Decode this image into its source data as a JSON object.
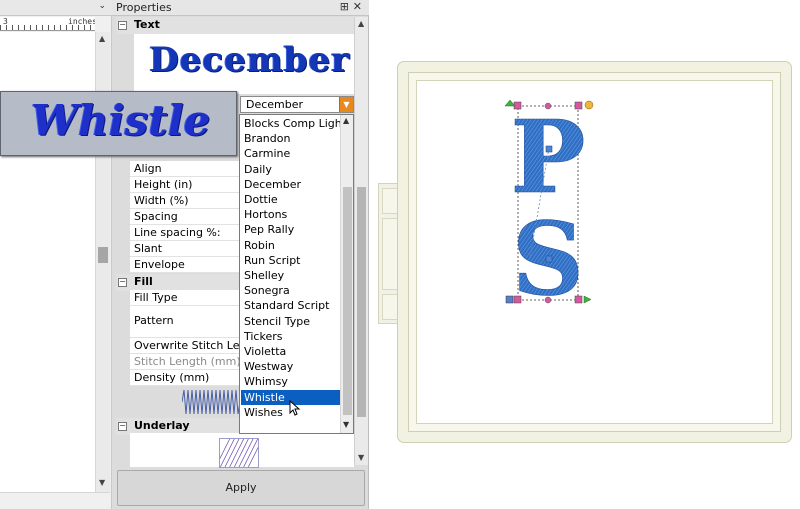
{
  "left_panel": {
    "ruler_number": "3",
    "ruler_unit": "inches",
    "header_chevron": "⌄"
  },
  "properties_panel": {
    "title": "Properties",
    "pin_glyph": "⊞",
    "close_glyph": "✕",
    "sections": {
      "text": {
        "label": "Text",
        "toggle": "−"
      },
      "fill": {
        "label": "Fill",
        "toggle": "−"
      },
      "underlay": {
        "label": "Underlay",
        "toggle": "−"
      }
    },
    "preview_text": "December",
    "font_combo_value": "December",
    "text_properties": [
      "Align",
      "Height (in)",
      "Width (%)",
      "Spacing",
      "Line spacing %:",
      "Slant",
      "Envelope"
    ],
    "fill_properties": {
      "fill_type": "Fill Type",
      "pattern": "Pattern",
      "overwrite": "Overwrite Stitch Leng...",
      "stitch_length": "Stitch Length (mm)",
      "density": "Density (mm)"
    },
    "apply_label": "Apply"
  },
  "font_list": {
    "items": [
      "Blocks Comp Light",
      "Brandon",
      "Carmine",
      "Daily",
      "December",
      "Dottie",
      "Hortons",
      "Pep Rally",
      "Robin",
      "Run Script",
      "Shelley",
      "Sonegra",
      "Standard Script",
      "Stencil Type",
      "Tickers",
      "Violetta",
      "Westway",
      "Whimsy",
      "Whistle",
      "Wishes"
    ],
    "selected": "Whistle"
  },
  "font_tooltip": {
    "text": "Whistle"
  },
  "design": {
    "letters": [
      "P",
      "S"
    ],
    "thread_color": "#2e6fc4"
  },
  "colors": {
    "accent_dropdown": "#e8891e",
    "selection": "#0b5fc1",
    "preview_blue": "#1437b8"
  }
}
